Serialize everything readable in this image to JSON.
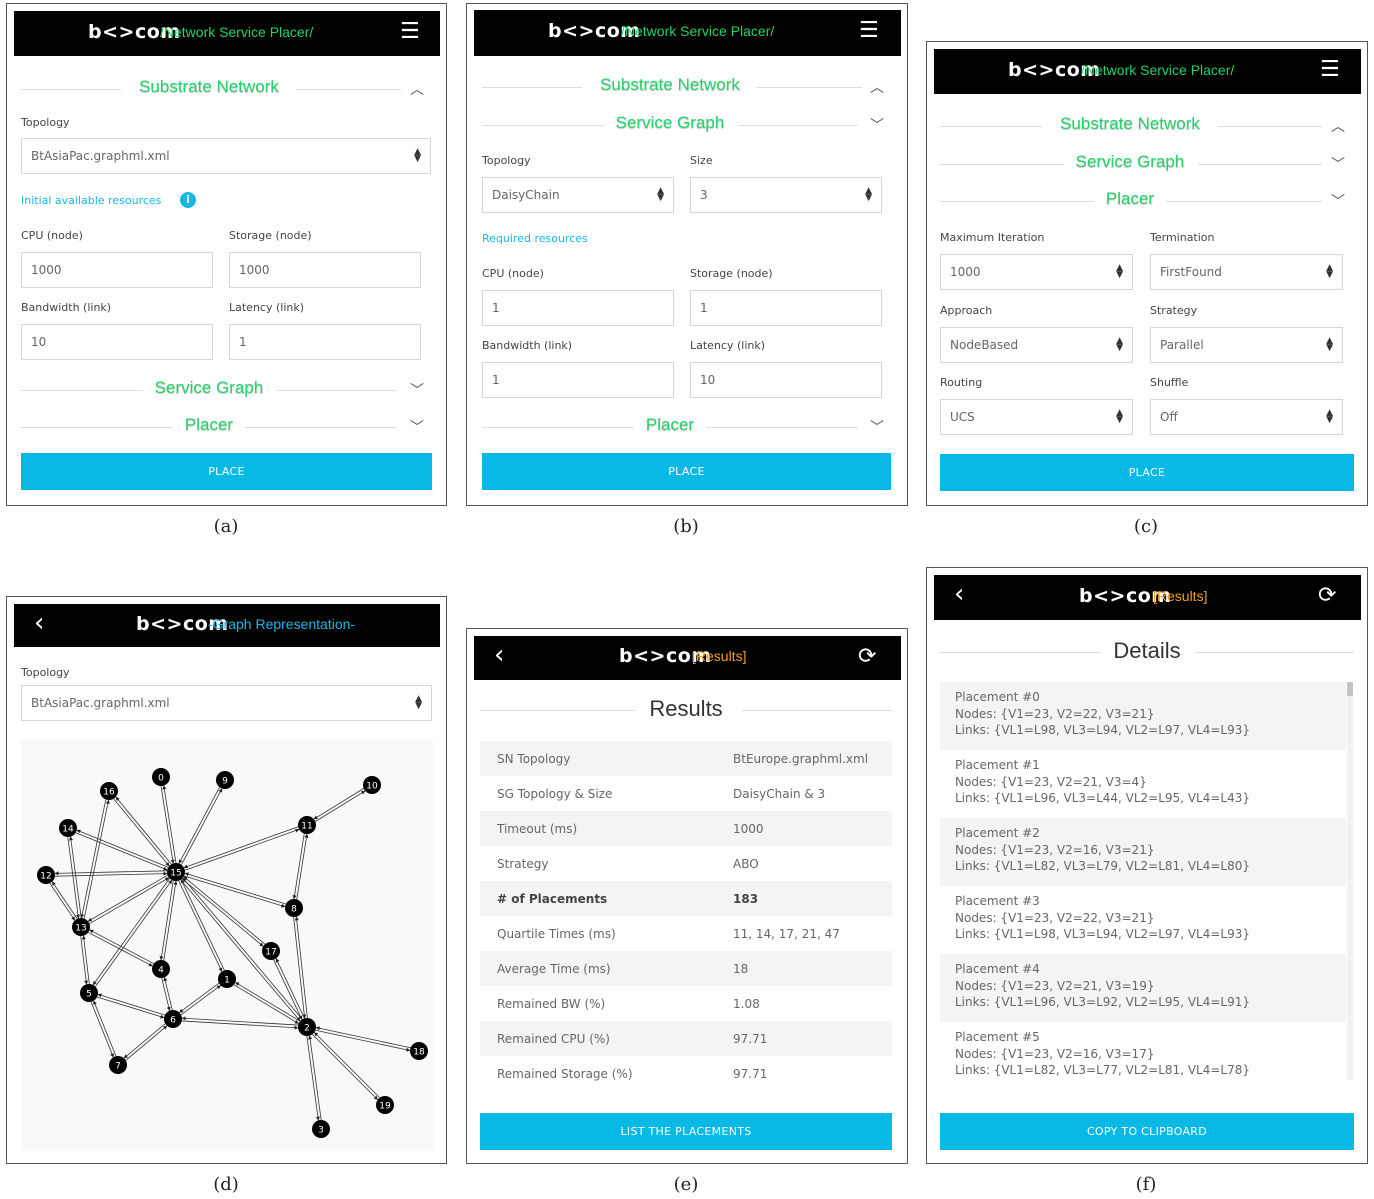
{
  "brand": "b<>com",
  "header": {
    "network_placer": "/Network Service Placer/",
    "graph_rep": "-Graph Representation-",
    "results": "[Results]"
  },
  "sections": {
    "substrate": "Substrate Network",
    "service_graph": "Service Graph",
    "placer": "Placer"
  },
  "panel_a": {
    "topology_label": "Topology",
    "topology_value": "BtAsiaPac.graphml.xml",
    "resources_link": "Initial available resources",
    "cpu_label": "CPU (node)",
    "cpu_value": "1000",
    "storage_label": "Storage (node)",
    "storage_value": "1000",
    "bw_label": "Bandwidth (link)",
    "bw_value": "10",
    "lat_label": "Latency (link)",
    "lat_value": "1",
    "place": "PLACE"
  },
  "panel_b": {
    "topology_label": "Topology",
    "topology_value": "DaisyChain",
    "size_label": "Size",
    "size_value": "3",
    "resources_link": "Required resources",
    "cpu_label": "CPU (node)",
    "cpu_value": "1",
    "storage_label": "Storage (node)",
    "storage_value": "1",
    "bw_label": "Bandwidth (link)",
    "bw_value": "1",
    "lat_label": "Latency (link)",
    "lat_value": "10",
    "place": "PLACE"
  },
  "panel_c": {
    "max_iter_label": "Maximum Iteration",
    "max_iter_value": "1000",
    "term_label": "Termination",
    "term_value": "FirstFound",
    "approach_label": "Approach",
    "approach_value": "NodeBased",
    "strategy_label": "Strategy",
    "strategy_value": "Parallel",
    "routing_label": "Routing",
    "routing_value": "UCS",
    "shuffle_label": "Shuffle",
    "shuffle_value": "Off",
    "place": "PLACE"
  },
  "panel_d": {
    "topology_label": "Topology",
    "topology_value": "BtAsiaPac.graphml.xml",
    "nodes": [
      "0",
      "1",
      "2",
      "3",
      "4",
      "5",
      "6",
      "7",
      "8",
      "9",
      "10",
      "11",
      "12",
      "13",
      "14",
      "15",
      "16",
      "17",
      "18",
      "19"
    ]
  },
  "panel_e": {
    "title": "Results",
    "rows": [
      {
        "k": "SN Topology",
        "v": "BtEurope.graphml.xml"
      },
      {
        "k": "SG Topology & Size",
        "v": "DaisyChain & 3"
      },
      {
        "k": "Timeout (ms)",
        "v": "1000"
      },
      {
        "k": "Strategy",
        "v": "ABO"
      },
      {
        "k": "# of Placements",
        "v": "183"
      },
      {
        "k": "Quartile Times (ms)",
        "v": "11, 14, 17, 21, 47"
      },
      {
        "k": "Average Time (ms)",
        "v": "18"
      },
      {
        "k": "Remained BW (%)",
        "v": "1.08"
      },
      {
        "k": "Remained CPU (%)",
        "v": "97.71"
      },
      {
        "k": "Remained Storage (%)",
        "v": "97.71"
      }
    ],
    "button": "LIST THE PLACEMENTS"
  },
  "panel_f": {
    "title": "Details",
    "placements": [
      {
        "name": "Placement #0",
        "nodes": "Nodes: {V1=23, V2=22, V3=21}",
        "links": "Links: {VL1=L98, VL3=L94, VL2=L97, VL4=L93}"
      },
      {
        "name": "Placement #1",
        "nodes": "Nodes: {V1=23, V2=21, V3=4}",
        "links": "Links: {VL1=L96, VL3=L44, VL2=L95, VL4=L43}"
      },
      {
        "name": "Placement #2",
        "nodes": "Nodes: {V1=23, V2=16, V3=21}",
        "links": "Links: {VL1=L82, VL3=L79, VL2=L81, VL4=L80}"
      },
      {
        "name": "Placement #3",
        "nodes": "Nodes: {V1=23, V2=22, V3=21}",
        "links": "Links: {VL1=L98, VL3=L94, VL2=L97, VL4=L93}"
      },
      {
        "name": "Placement #4",
        "nodes": "Nodes: {V1=23, V2=21, V3=19}",
        "links": "Links: {VL1=L96, VL3=L92, VL2=L95, VL4=L91}"
      },
      {
        "name": "Placement #5",
        "nodes": "Nodes: {V1=23, V2=16, V3=17}",
        "links": "Links: {VL1=L82, VL3=L77, VL2=L81, VL4=L78}"
      }
    ],
    "button": "COPY TO CLIPBOARD"
  },
  "captions": {
    "a": "(a)",
    "b": "(b)",
    "c": "(c)",
    "d": "(d)",
    "e": "(e)",
    "f": "(f)"
  }
}
